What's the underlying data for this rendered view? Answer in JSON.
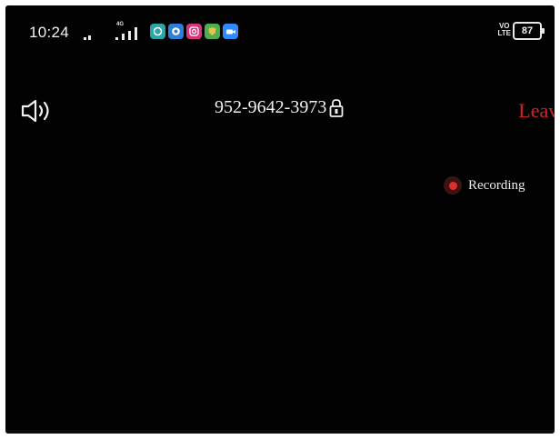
{
  "status_bar": {
    "time": "10:24",
    "network_label": "4G",
    "volte_top": "VO",
    "volte_bottom": "LTE",
    "battery": "87",
    "app_icons": [
      {
        "name": "whatsapp-icon",
        "color": "#2aa6a8"
      },
      {
        "name": "browser-icon",
        "color": "#2f7fd6"
      },
      {
        "name": "instagram-icon",
        "color": "#d6347d"
      },
      {
        "name": "shield-app-icon",
        "color": "#4caf50"
      },
      {
        "name": "zoom-icon",
        "color": "#2d8cff"
      }
    ]
  },
  "meeting": {
    "meeting_id": "952-9642-3973",
    "leave_label": "Leave",
    "recording_label": "Recording"
  },
  "colors": {
    "background": "#020202",
    "leave": "#d6232a",
    "recording_dot": "#e22b2b",
    "text": "#f0f0f0"
  },
  "icons": {
    "speaker": "speaker-icon",
    "lock": "lock-icon"
  }
}
